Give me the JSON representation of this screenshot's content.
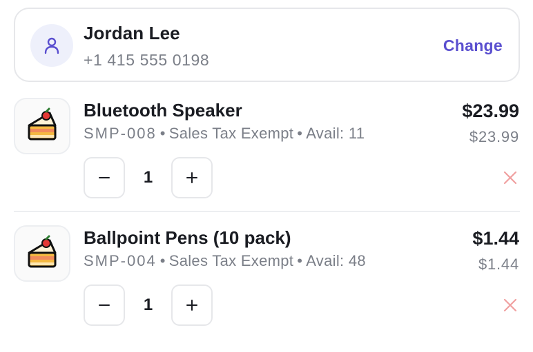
{
  "customer": {
    "name": "Jordan Lee",
    "phone": "+1 415 555 0198",
    "change_label": "Change",
    "avatar_icon": "user-icon"
  },
  "items": [
    {
      "name": "Bluetooth Speaker",
      "sku": "SMP-008",
      "tax": "Sales Tax Exempt",
      "avail": "Avail: 11",
      "price": "$23.99",
      "unit_price": "$23.99",
      "quantity": "1",
      "thumbnail_icon": "cake-slice-icon"
    },
    {
      "name": "Ballpoint Pens (10 pack)",
      "sku": "SMP-004",
      "tax": "Sales Tax Exempt",
      "avail": "Avail: 48",
      "price": "$1.44",
      "unit_price": "$1.44",
      "quantity": "1",
      "thumbnail_icon": "cake-slice-icon"
    }
  ],
  "separator": "•",
  "colors": {
    "accent": "#5a4fcf",
    "remove": "#f0a0a0",
    "muted_text": "#7b7f88",
    "border": "#e6e7ea"
  }
}
